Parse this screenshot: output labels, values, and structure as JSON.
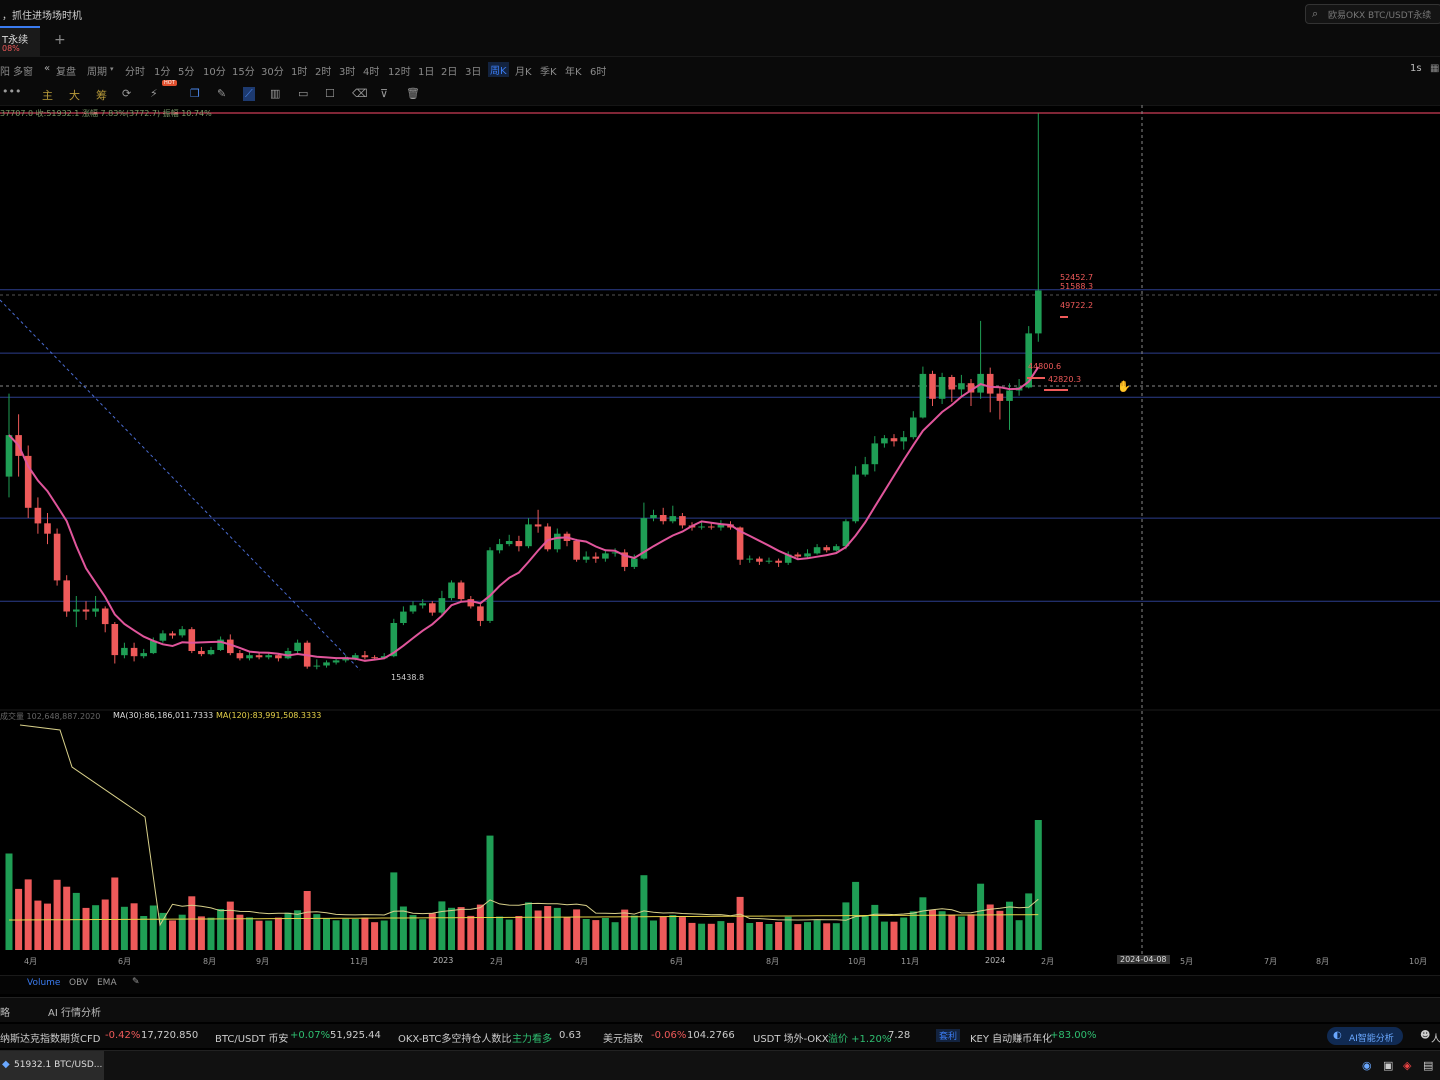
{
  "topbar": {
    "title": "，抓住进场场时机",
    "search_placeholder": "欧易OKX BTC/USDT永续"
  },
  "tab": {
    "label": "T永续",
    "sub": "08%",
    "add": "+"
  },
  "periodbar": {
    "items": [
      "阳",
      "多窗",
      "复盘",
      "周期",
      "分时",
      "1分",
      "5分",
      "10分",
      "15分",
      "30分",
      "1时",
      "2时",
      "3时",
      "4时",
      "12时",
      "1日",
      "2日",
      "3日",
      "周K",
      "月K",
      "季K",
      "年K",
      "6时"
    ],
    "active": "周K",
    "right": "1s"
  },
  "toolbar": {
    "menu": "•••",
    "main": "主",
    "big": "大",
    "chip": "筹",
    "hot": "HOT"
  },
  "price_info": "37707.0 收:51932.1 涨幅 7.83%(3772.7) 振幅 10.74%",
  "vol_info": {
    "label": "成交量 102,648,887.2020",
    "ma30": "MA(30):86,186,011.7333",
    "ma120": "MA(120):83,991,508.3333"
  },
  "annotations": {
    "low": "15438.8",
    "p1": "52452.7",
    "p2": "51588.3",
    "p3": "49722.2",
    "p4": "44800.6",
    "p5": "42820.3"
  },
  "xaxis": {
    "labels": [
      "4月",
      "6月",
      "8月",
      "9月",
      "11月",
      "2023",
      "2月",
      "4月",
      "6月",
      "8月",
      "10月",
      "11月",
      "2024",
      "2月",
      "5月",
      "7月",
      "8月",
      "10月"
    ],
    "crosshair_date": "2024-04-08"
  },
  "indicators": {
    "items": [
      "Volume",
      "OBV",
      "EMA"
    ]
  },
  "panel": {
    "left": "略",
    "ai": "AI 行情分析"
  },
  "ticker": {
    "items": [
      {
        "name": "纳斯达克指数期货CFD",
        "chg": "-0.42%",
        "val": "17,720.850",
        "dir": "dn"
      },
      {
        "name": "BTC/USDT 币安",
        "chg": "+0.07%",
        "val": "51,925.44",
        "dir": "up"
      },
      {
        "name": "OKX-BTC多空持仓人数比",
        "chg": "主力看多",
        "val": "0.63",
        "dir": "up"
      },
      {
        "name": "美元指数",
        "chg": "-0.06%",
        "val": "104.2766",
        "dir": "dn"
      },
      {
        "name": "USDT 场外-OKX",
        "chg": "溢价 +1.20%",
        "val": "7.28",
        "dir": "up"
      }
    ],
    "arb_tag": "套利",
    "key_text": "KEY 自动赚币年化",
    "key_val": "+83.00%",
    "ai_btn": "AI智能分析",
    "person": "人"
  },
  "taskbar": {
    "item": "51932.1 BTC/USD..."
  },
  "colors": {
    "up": "#1f9e55",
    "down": "#ee5a5a",
    "ma": "#e0559b",
    "vol_ma30": "#d8d08a",
    "vol_ma120": "#e6d24a",
    "hline": "#2c3e8c",
    "price_line": "#ff4d6d"
  },
  "chart_data": {
    "type": "candlestick",
    "series": [
      {
        "o": 34000,
        "c": 38000,
        "h": 42000,
        "l": 32000
      },
      {
        "o": 38000,
        "c": 36000,
        "h": 40000,
        "l": 34000
      },
      {
        "o": 36000,
        "c": 31000,
        "h": 37000,
        "l": 30000
      },
      {
        "o": 31000,
        "c": 29500,
        "h": 32000,
        "l": 28500
      },
      {
        "o": 29500,
        "c": 28500,
        "h": 30500,
        "l": 27500
      },
      {
        "o": 28500,
        "c": 24000,
        "h": 29000,
        "l": 23500
      },
      {
        "o": 24000,
        "c": 21000,
        "h": 24500,
        "l": 20500
      },
      {
        "o": 21000,
        "c": 21200,
        "h": 22500,
        "l": 19500
      },
      {
        "o": 21200,
        "c": 21000,
        "h": 22000,
        "l": 20200
      },
      {
        "o": 21000,
        "c": 21300,
        "h": 22500,
        "l": 20500
      },
      {
        "o": 21300,
        "c": 19800,
        "h": 21500,
        "l": 19000
      },
      {
        "o": 19800,
        "c": 16800,
        "h": 20000,
        "l": 16000
      },
      {
        "o": 16800,
        "c": 17500,
        "h": 18000,
        "l": 16500
      },
      {
        "o": 17500,
        "c": 16700,
        "h": 18000,
        "l": 16200
      },
      {
        "o": 16700,
        "c": 17000,
        "h": 17400,
        "l": 16500
      },
      {
        "o": 17000,
        "c": 18200,
        "h": 18500,
        "l": 16900
      },
      {
        "o": 18200,
        "c": 18900,
        "h": 19200,
        "l": 18000
      },
      {
        "o": 18900,
        "c": 18700,
        "h": 19100,
        "l": 18400
      },
      {
        "o": 18700,
        "c": 19300,
        "h": 19600,
        "l": 18500
      },
      {
        "o": 19300,
        "c": 17200,
        "h": 19500,
        "l": 17000
      },
      {
        "o": 17200,
        "c": 16900,
        "h": 17600,
        "l": 16700
      },
      {
        "o": 16900,
        "c": 17300,
        "h": 17600,
        "l": 16800
      },
      {
        "o": 17300,
        "c": 18300,
        "h": 18600,
        "l": 17200
      },
      {
        "o": 18300,
        "c": 17000,
        "h": 18800,
        "l": 16800
      },
      {
        "o": 17000,
        "c": 16500,
        "h": 17300,
        "l": 16300
      },
      {
        "o": 16500,
        "c": 16800,
        "h": 17100,
        "l": 16300
      },
      {
        "o": 16800,
        "c": 16600,
        "h": 17000,
        "l": 16400
      },
      {
        "o": 16600,
        "c": 16800,
        "h": 17000,
        "l": 16400
      },
      {
        "o": 16800,
        "c": 16500,
        "h": 17000,
        "l": 16200
      },
      {
        "o": 16500,
        "c": 17200,
        "h": 17500,
        "l": 16400
      },
      {
        "o": 17200,
        "c": 18000,
        "h": 18300,
        "l": 17000
      },
      {
        "o": 18000,
        "c": 15700,
        "h": 18200,
        "l": 15500
      },
      {
        "o": 15700,
        "c": 15800,
        "h": 16400,
        "l": 15438
      },
      {
        "o": 15800,
        "c": 16100,
        "h": 16300,
        "l": 15600
      },
      {
        "o": 16100,
        "c": 16300,
        "h": 16500,
        "l": 15900
      },
      {
        "o": 16300,
        "c": 16500,
        "h": 16800,
        "l": 16100
      },
      {
        "o": 16500,
        "c": 16800,
        "h": 17000,
        "l": 16300
      },
      {
        "o": 16800,
        "c": 16600,
        "h": 17200,
        "l": 16400
      },
      {
        "o": 16600,
        "c": 16500,
        "h": 16800,
        "l": 16300
      },
      {
        "o": 16500,
        "c": 16700,
        "h": 17000,
        "l": 16400
      },
      {
        "o": 16700,
        "c": 19900,
        "h": 20300,
        "l": 16600
      },
      {
        "o": 19900,
        "c": 21000,
        "h": 21500,
        "l": 19700
      },
      {
        "o": 21000,
        "c": 21600,
        "h": 22000,
        "l": 20800
      },
      {
        "o": 21600,
        "c": 21800,
        "h": 22200,
        "l": 21300
      },
      {
        "o": 21800,
        "c": 20900,
        "h": 22000,
        "l": 20600
      },
      {
        "o": 20900,
        "c": 22300,
        "h": 23000,
        "l": 20700
      },
      {
        "o": 22300,
        "c": 23800,
        "h": 24000,
        "l": 22100
      },
      {
        "o": 23800,
        "c": 22200,
        "h": 24000,
        "l": 21900
      },
      {
        "o": 22200,
        "c": 21500,
        "h": 22500,
        "l": 21300
      },
      {
        "o": 21500,
        "c": 20100,
        "h": 21700,
        "l": 19600
      },
      {
        "o": 20100,
        "c": 26900,
        "h": 27200,
        "l": 19900
      },
      {
        "o": 26900,
        "c": 27500,
        "h": 28000,
        "l": 26600
      },
      {
        "o": 27500,
        "c": 27800,
        "h": 28400,
        "l": 27300
      },
      {
        "o": 27800,
        "c": 27300,
        "h": 28300,
        "l": 26800
      },
      {
        "o": 27300,
        "c": 29400,
        "h": 30000,
        "l": 27100
      },
      {
        "o": 29400,
        "c": 29200,
        "h": 30800,
        "l": 28600
      },
      {
        "o": 29200,
        "c": 27000,
        "h": 29500,
        "l": 26800
      },
      {
        "o": 27000,
        "c": 28500,
        "h": 29000,
        "l": 26700
      },
      {
        "o": 28500,
        "c": 27800,
        "h": 28700,
        "l": 27300
      },
      {
        "o": 27800,
        "c": 26000,
        "h": 28000,
        "l": 25800
      },
      {
        "o": 26000,
        "c": 26300,
        "h": 26800,
        "l": 25700
      },
      {
        "o": 26300,
        "c": 26100,
        "h": 26700,
        "l": 25700
      },
      {
        "o": 26100,
        "c": 26600,
        "h": 27000,
        "l": 25800
      },
      {
        "o": 26600,
        "c": 26700,
        "h": 27100,
        "l": 26300
      },
      {
        "o": 26700,
        "c": 25300,
        "h": 27000,
        "l": 24900
      },
      {
        "o": 25300,
        "c": 26100,
        "h": 26500,
        "l": 25100
      },
      {
        "o": 26100,
        "c": 30000,
        "h": 31500,
        "l": 26000
      },
      {
        "o": 30000,
        "c": 30300,
        "h": 30800,
        "l": 29700
      },
      {
        "o": 30300,
        "c": 29700,
        "h": 31000,
        "l": 29400
      },
      {
        "o": 29700,
        "c": 30200,
        "h": 31200,
        "l": 29500
      },
      {
        "o": 30200,
        "c": 29300,
        "h": 30500,
        "l": 29000
      },
      {
        "o": 29300,
        "c": 29100,
        "h": 29600,
        "l": 28800
      },
      {
        "o": 29100,
        "c": 29200,
        "h": 29600,
        "l": 28900
      },
      {
        "o": 29200,
        "c": 29100,
        "h": 29600,
        "l": 28900
      },
      {
        "o": 29100,
        "c": 29400,
        "h": 29800,
        "l": 28800
      },
      {
        "o": 29400,
        "c": 29100,
        "h": 29700,
        "l": 28900
      },
      {
        "o": 29100,
        "c": 26000,
        "h": 29200,
        "l": 25500
      },
      {
        "o": 26000,
        "c": 26100,
        "h": 26400,
        "l": 25700
      },
      {
        "o": 26100,
        "c": 25800,
        "h": 26300,
        "l": 25500
      },
      {
        "o": 25800,
        "c": 25900,
        "h": 26200,
        "l": 25600
      },
      {
        "o": 25900,
        "c": 25700,
        "h": 26100,
        "l": 25300
      },
      {
        "o": 25700,
        "c": 26500,
        "h": 26800,
        "l": 25500
      },
      {
        "o": 26500,
        "c": 26300,
        "h": 26700,
        "l": 26100
      },
      {
        "o": 26300,
        "c": 26600,
        "h": 27000,
        "l": 26200
      },
      {
        "o": 26600,
        "c": 27200,
        "h": 27500,
        "l": 26500
      },
      {
        "o": 27200,
        "c": 26900,
        "h": 27400,
        "l": 26700
      },
      {
        "o": 26900,
        "c": 27300,
        "h": 27500,
        "l": 26800
      },
      {
        "o": 27300,
        "c": 29700,
        "h": 29900,
        "l": 27000
      },
      {
        "o": 29700,
        "c": 34200,
        "h": 35000,
        "l": 29500
      },
      {
        "o": 34200,
        "c": 35200,
        "h": 35900,
        "l": 34000
      },
      {
        "o": 35200,
        "c": 37200,
        "h": 37900,
        "l": 34500
      },
      {
        "o": 37200,
        "c": 37700,
        "h": 38000,
        "l": 36800
      },
      {
        "o": 37700,
        "c": 37400,
        "h": 38100,
        "l": 36900
      },
      {
        "o": 37400,
        "c": 37800,
        "h": 38400,
        "l": 36600
      },
      {
        "o": 37800,
        "c": 39700,
        "h": 40300,
        "l": 37600
      },
      {
        "o": 39700,
        "c": 43900,
        "h": 44600,
        "l": 39600
      },
      {
        "o": 43900,
        "c": 41500,
        "h": 44200,
        "l": 40800
      },
      {
        "o": 41500,
        "c": 43600,
        "h": 44000,
        "l": 41000
      },
      {
        "o": 43600,
        "c": 42400,
        "h": 43800,
        "l": 41200
      },
      {
        "o": 42400,
        "c": 43000,
        "h": 43800,
        "l": 41600
      },
      {
        "o": 43000,
        "c": 42100,
        "h": 43400,
        "l": 40800
      },
      {
        "o": 42100,
        "c": 43900,
        "h": 49000,
        "l": 41500
      },
      {
        "o": 43900,
        "c": 42000,
        "h": 44500,
        "l": 40200
      },
      {
        "o": 42000,
        "c": 41300,
        "h": 42600,
        "l": 39500
      },
      {
        "o": 41300,
        "c": 42300,
        "h": 43000,
        "l": 38500
      },
      {
        "o": 42300,
        "c": 42600,
        "h": 43400,
        "l": 41800
      },
      {
        "o": 42600,
        "c": 47800,
        "h": 48500,
        "l": 42500
      },
      {
        "o": 47800,
        "c": 51932,
        "h": 69000,
        "l": 47000
      }
    ]
  }
}
